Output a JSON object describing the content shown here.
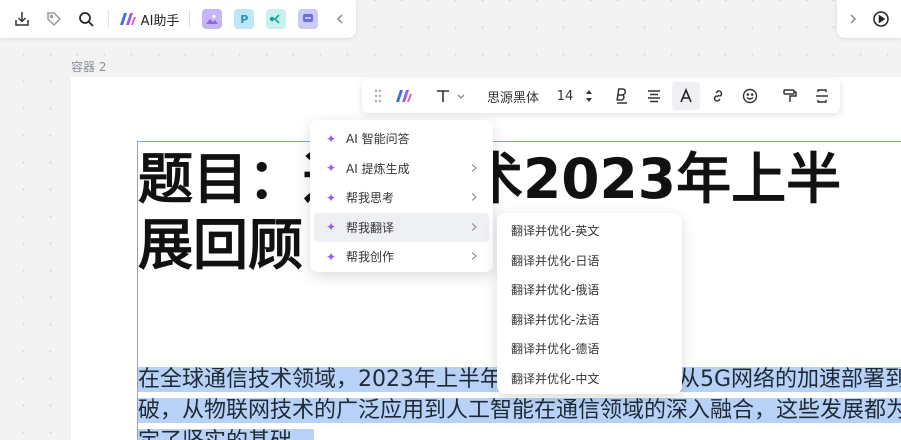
{
  "top_toolbar": {
    "ai_assistant_label": "AI助手",
    "apps": [
      {
        "name": "image-app",
        "color": "#c7b6f7",
        "glyph": ""
      },
      {
        "name": "p-app",
        "color": "#bfe6f6",
        "glyph": "P"
      },
      {
        "name": "mindmap-app",
        "color": "#c6f1ec",
        "glyph": ""
      },
      {
        "name": "chat-app",
        "color": "#c9ccf7",
        "glyph": ""
      }
    ]
  },
  "container_label": "容器 2",
  "document": {
    "title_line1": "题目：通信技术2023年上半",
    "title_line2": "展回顾",
    "body_line1": "在全球通信技术领域，2023年上半年取得了显著进展。从5G网络的加速部署到",
    "body_line2": "破，从物联网技术的广泛应用到人工智能在通信领域的深入融合，这些发展都为未",
    "body_line3": "定了坚实的基础。"
  },
  "format_bar": {
    "font_family": "思源黑体",
    "font_size": "14"
  },
  "ai_menu": {
    "items": [
      {
        "label": "AI 智能问答",
        "has_submenu": false
      },
      {
        "label": "AI 提炼生成",
        "has_submenu": true
      },
      {
        "label": "帮我思考",
        "has_submenu": true
      },
      {
        "label": "帮我翻译",
        "has_submenu": true
      },
      {
        "label": "帮我创作",
        "has_submenu": true
      }
    ],
    "active_index": 3
  },
  "translate_submenu": {
    "items": [
      "翻译并优化-英文",
      "翻译并优化-日语",
      "翻译并优化-俄语",
      "翻译并优化-法语",
      "翻译并优化-德语",
      "翻译并优化-中文"
    ]
  },
  "colors": {
    "accent": "#3e6fe0",
    "selection": "#b7d2f6",
    "sparkle": "#9b5cf0"
  }
}
